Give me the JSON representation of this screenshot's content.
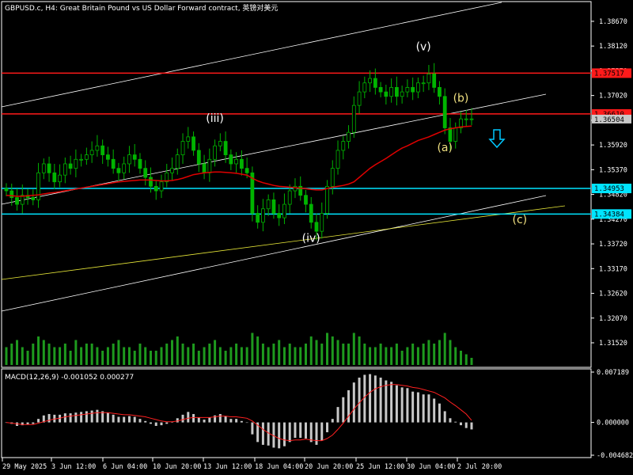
{
  "window": {
    "title": "GBPUSD.c, H4:  Great Britain Pound vs US Dollar Forward contract, 英镑对美元"
  },
  "colors": {
    "background": "#000000",
    "axis": "#ffffff",
    "candle": "#00b400",
    "ma": "#e00000",
    "resistance": "#ff1a1a",
    "support": "#00e5ff",
    "channel": "#ffffff",
    "trend_yellow": "#e8e838",
    "volume": "#1e9a1e",
    "macd_hist": "#c8c8c8",
    "macd_signal": "#ff2020",
    "label_white": "#ffffff",
    "label_yellow": "#f0e080",
    "arrow": "#00c8ff"
  },
  "chart_data": {
    "type": "candlestick",
    "symbol": "GBPUSD.c",
    "timeframe": "H4",
    "price_axis_ticks": [
      "1.38670",
      "1.38120",
      "1.37570",
      "1.37020",
      "1.36470",
      "1.35920",
      "1.35370",
      "1.34820",
      "1.34270",
      "1.33720",
      "1.33170",
      "1.32620",
      "1.32070",
      "1.31520"
    ],
    "ylim": [
      1.3152,
      1.3888
    ],
    "date_axis_ticks": [
      "29 May 2025",
      "3 Jun 12:00",
      "6 Jun 04:00",
      "10 Jun 20:00",
      "13 Jun 12:00",
      "18 Jun 04:00",
      "20 Jun 20:00",
      "25 Jun 12:00",
      "30 Jun 04:00",
      "2 Jul 20:00"
    ],
    "price_levels": [
      {
        "price": "1.37517",
        "price_value": 1.37517,
        "kind": "resistance"
      },
      {
        "price": "1.36610",
        "price_value": 1.3661,
        "kind": "resistance"
      },
      {
        "price": "1.34953",
        "price_value": 1.34953,
        "kind": "support"
      },
      {
        "price": "1.34384",
        "price_value": 1.34384,
        "kind": "support"
      }
    ],
    "current_price": "1.36504",
    "current_price_value": 1.36504,
    "wave_labels": [
      {
        "text": "(iii)",
        "color": "white"
      },
      {
        "text": "(iv)",
        "color": "white"
      },
      {
        "text": "(v)",
        "color": "white"
      },
      {
        "text": "(a)",
        "color": "yellow"
      },
      {
        "text": "(b)",
        "color": "yellow"
      },
      {
        "text": "(c)",
        "color": "yellow"
      }
    ],
    "closes": [
      1.349,
      1.3475,
      1.346,
      1.348,
      1.3475,
      1.347,
      1.353,
      1.355,
      1.353,
      1.351,
      1.3525,
      1.355,
      1.354,
      1.356,
      1.356,
      1.357,
      1.358,
      1.359,
      1.357,
      1.356,
      1.354,
      1.353,
      1.355,
      1.357,
      1.356,
      1.354,
      1.352,
      1.35,
      1.349,
      1.351,
      1.353,
      1.354,
      1.357,
      1.36,
      1.361,
      1.358,
      1.355,
      1.353,
      1.356,
      1.359,
      1.36,
      1.357,
      1.355,
      1.356,
      1.354,
      1.353,
      1.344,
      1.342,
      1.345,
      1.347,
      1.344,
      1.343,
      1.346,
      1.349,
      1.35,
      1.348,
      1.346,
      1.342,
      1.34,
      1.344,
      1.35,
      1.354,
      1.358,
      1.36,
      1.362,
      1.368,
      1.371,
      1.373,
      1.374,
      1.372,
      1.371,
      1.37,
      1.372,
      1.37,
      1.371,
      1.372,
      1.371,
      1.373,
      1.373,
      1.375,
      1.372,
      1.37,
      1.363,
      1.36,
      1.363,
      1.365,
      1.365,
      1.365
    ],
    "ma_values": [
      1.348,
      1.3479,
      1.3478,
      1.3478,
      1.3479,
      1.348,
      1.3481,
      1.3483,
      1.3485,
      1.3486,
      1.3488,
      1.349,
      1.3492,
      1.3494,
      1.3496,
      1.3498,
      1.35,
      1.3502,
      1.3504,
      1.3506,
      1.3508,
      1.351,
      1.3511,
      1.3512,
      1.3513,
      1.3514,
      1.3514,
      1.3514,
      1.3513,
      1.3512,
      1.3512,
      1.3513,
      1.3515,
      1.3518,
      1.3522,
      1.3526,
      1.3528,
      1.353,
      1.3531,
      1.3532,
      1.3532,
      1.3531,
      1.353,
      1.3529,
      1.3527,
      1.3525,
      1.3518,
      1.3512,
      1.3508,
      1.3505,
      1.3502,
      1.35,
      1.3499,
      1.3498,
      1.3497,
      1.3496,
      1.3495,
      1.3493,
      1.3492,
      1.3492,
      1.3495,
      1.3498,
      1.35,
      1.3502,
      1.3505,
      1.351,
      1.352,
      1.353,
      1.354,
      1.3548,
      1.3555,
      1.3562,
      1.357,
      1.3578,
      1.3585,
      1.359,
      1.3596,
      1.3602,
      1.3606,
      1.361,
      1.3615,
      1.362,
      1.3625,
      1.3628,
      1.363,
      1.3632,
      1.3633,
      1.3634
    ],
    "volume": [
      0.5,
      0.6,
      0.7,
      0.5,
      0.4,
      0.6,
      0.8,
      0.7,
      0.6,
      0.5,
      0.5,
      0.6,
      0.4,
      0.7,
      0.5,
      0.6,
      0.6,
      0.5,
      0.4,
      0.5,
      0.6,
      0.7,
      0.5,
      0.5,
      0.4,
      0.6,
      0.5,
      0.4,
      0.4,
      0.5,
      0.6,
      0.7,
      0.8,
      0.6,
      0.5,
      0.6,
      0.4,
      0.5,
      0.6,
      0.7,
      0.5,
      0.4,
      0.5,
      0.6,
      0.5,
      0.5,
      0.9,
      0.8,
      0.6,
      0.5,
      0.6,
      0.7,
      0.5,
      0.6,
      0.5,
      0.5,
      0.6,
      0.8,
      0.7,
      0.6,
      0.9,
      0.8,
      0.7,
      0.6,
      0.6,
      0.9,
      0.8,
      0.6,
      0.5,
      0.5,
      0.6,
      0.5,
      0.5,
      0.6,
      0.4,
      0.5,
      0.6,
      0.5,
      0.6,
      0.7,
      0.6,
      0.7,
      0.9,
      0.7,
      0.5,
      0.4,
      0.3,
      0.2
    ],
    "macd": {
      "label": "MACD(12,26,9) -0.001052 0.000277",
      "axis_ticks": [
        "0.007189",
        "0.000000",
        "-0.004682"
      ],
      "ylim": [
        -0.004682,
        0.007189
      ],
      "hist": [
        0,
        -0.0002,
        -0.0005,
        -0.0004,
        -0.0003,
        -0.0002,
        0.0005,
        0.001,
        0.0012,
        0.0011,
        0.0011,
        0.0013,
        0.0013,
        0.0014,
        0.0015,
        0.0016,
        0.0017,
        0.0018,
        0.0016,
        0.0014,
        0.0011,
        0.0008,
        0.0008,
        0.0009,
        0.0008,
        0.0005,
        0.0002,
        -0.0002,
        -0.0005,
        -0.0004,
        -0.0002,
        0.0001,
        0.0006,
        0.0011,
        0.0015,
        0.0012,
        0.0007,
        0.0004,
        0.0007,
        0.001,
        0.0012,
        0.0009,
        0.0005,
        0.0005,
        0.0002,
        0.0,
        -0.0017,
        -0.0028,
        -0.0032,
        -0.0033,
        -0.0036,
        -0.0037,
        -0.0034,
        -0.0028,
        -0.0022,
        -0.0022,
        -0.0023,
        -0.0028,
        -0.0032,
        -0.0026,
        -0.0014,
        0.0005,
        0.0022,
        0.0036,
        0.0046,
        0.0057,
        0.0064,
        0.0068,
        0.0069,
        0.0067,
        0.0064,
        0.006,
        0.0058,
        0.0053,
        0.005,
        0.0049,
        0.0044,
        0.0043,
        0.004,
        0.004,
        0.0034,
        0.0027,
        0.0016,
        0.0006,
        0.0001,
        -0.0004,
        -0.0008,
        -0.001
      ],
      "signal": [
        0,
        -0.0001,
        -0.0002,
        -0.0003,
        -0.0003,
        -0.0003,
        -0.0001,
        0.0001,
        0.0003,
        0.0005,
        0.0006,
        0.0008,
        0.0009,
        0.001,
        0.0011,
        0.0012,
        0.0013,
        0.0014,
        0.0014,
        0.0014,
        0.0013,
        0.0012,
        0.0011,
        0.0011,
        0.001,
        0.0009,
        0.0008,
        0.0006,
        0.0004,
        0.0002,
        0.0001,
        0.0001,
        0.0002,
        0.0004,
        0.0006,
        0.0007,
        0.0007,
        0.0007,
        0.0007,
        0.0008,
        0.0009,
        0.0009,
        0.0008,
        0.0008,
        0.0007,
        0.0006,
        0.0002,
        -0.0004,
        -0.001,
        -0.0015,
        -0.0019,
        -0.0023,
        -0.0025,
        -0.0026,
        -0.0025,
        -0.0025,
        -0.0024,
        -0.0025,
        -0.0026,
        -0.0026,
        -0.0023,
        -0.0018,
        -0.001,
        -0.0001,
        0.0009,
        0.0019,
        0.0028,
        0.0036,
        0.0043,
        0.0048,
        0.0051,
        0.0053,
        0.0054,
        0.0054,
        0.0053,
        0.0052,
        0.005,
        0.0049,
        0.0047,
        0.0045,
        0.0043,
        0.0039,
        0.0035,
        0.0029,
        0.0024,
        0.0018,
        0.0012,
        0.0003
      ]
    }
  }
}
